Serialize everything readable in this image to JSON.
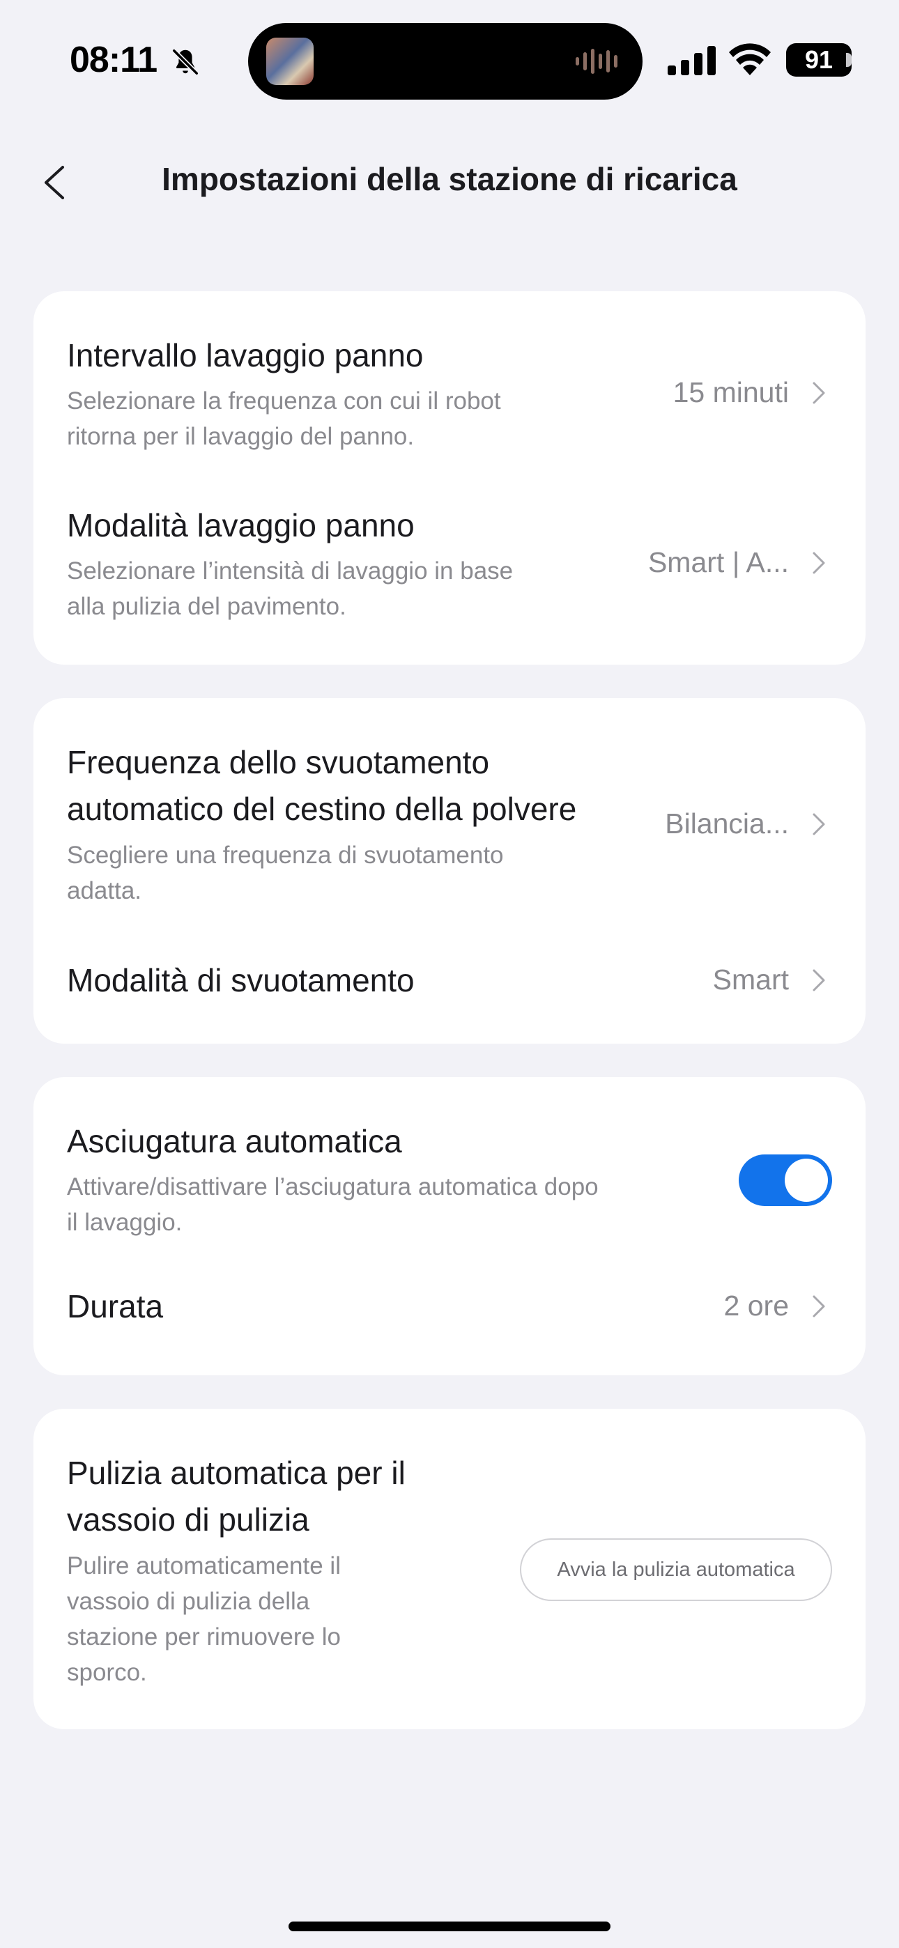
{
  "status_bar": {
    "time": "08:11",
    "battery": "91"
  },
  "header": {
    "title": "Impostazioni della stazione di ricarica"
  },
  "cards": {
    "mop": {
      "interval_title": "Intervallo lavaggio panno",
      "interval_desc_1": "Selezionare la frequenza con cui il robot",
      "interval_desc_2": "ritorna per il lavaggio del panno.",
      "interval_value": "15 minuti",
      "mode_title": "Modalità lavaggio panno",
      "mode_desc_1": "Selezionare l’intensità di lavaggio in base",
      "mode_desc_2": "alla pulizia del pavimento.",
      "mode_value": "Smart | A..."
    },
    "dust": {
      "frequency_title_1": "Frequenza dello svuotamento",
      "frequency_title_2": "automatico del cestino della polvere",
      "frequency_desc_1": "Scegliere una frequenza di svuotamento",
      "frequency_desc_2": "adatta.",
      "frequency_value": "Bilancia...",
      "empty_mode_title": "Modalità di svuotamento",
      "empty_mode_value": "Smart"
    },
    "drying": {
      "auto_dry_title": "Asciugatura automatica",
      "auto_dry_desc_1": "Attivare/disattivare l’asciugatura automatica dopo",
      "auto_dry_desc_2": "il lavaggio.",
      "auto_dry_enabled": true,
      "duration_title": "Durata",
      "duration_value": "2 ore"
    },
    "tray": {
      "title_1": "Pulizia automatica per il",
      "title_2": "vassoio di pulizia",
      "desc_1": "Pulire automaticamente il",
      "desc_2": "vassoio di pulizia della",
      "desc_3": "stazione per rimuovere lo",
      "desc_4": "sporco.",
      "button_label": "Avvia la pulizia automatica"
    }
  },
  "colors": {
    "background": "#f2f2f7",
    "card": "#ffffff",
    "accent": "#1273eb",
    "secondary_text": "#8a8a8f"
  }
}
